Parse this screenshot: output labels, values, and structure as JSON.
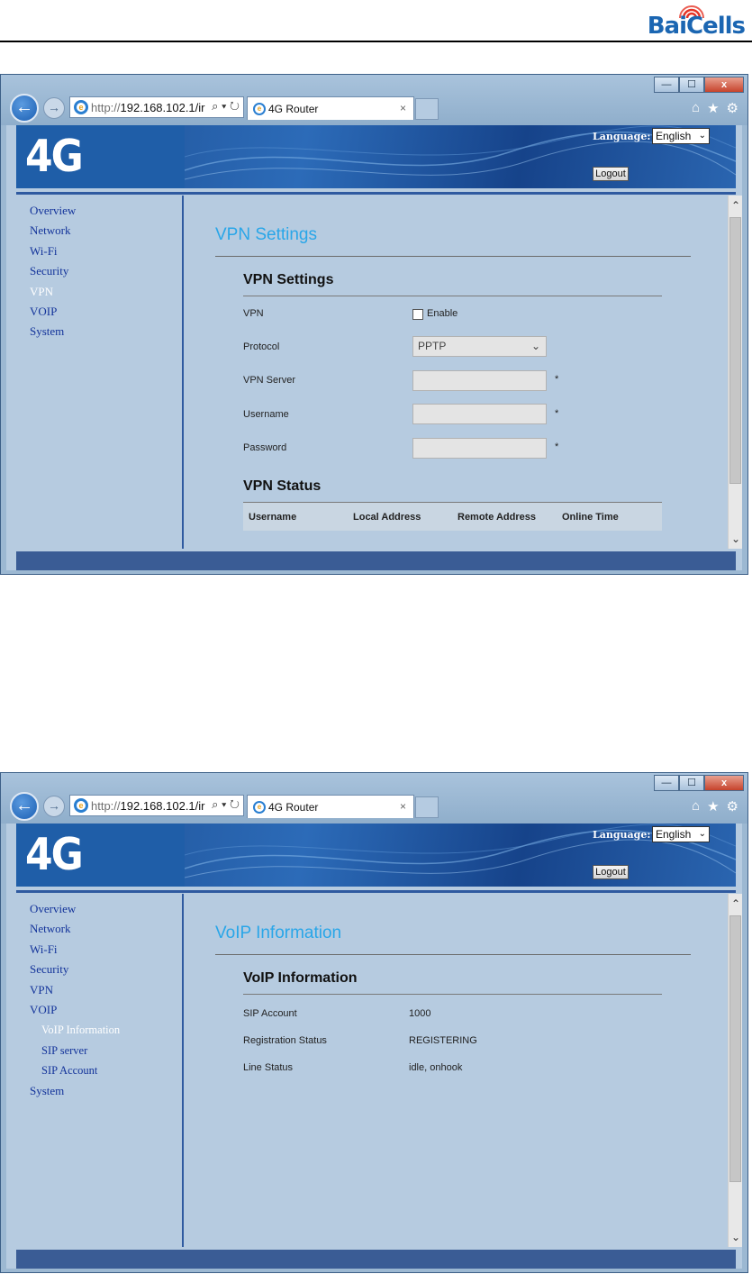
{
  "doc_logo": {
    "text": "BaiCells"
  },
  "browser": {
    "url_proto": "http://",
    "url_host": "192.168.102.1/ir",
    "addr_tools": "⌕ ▾ ↻",
    "tab_title": "4G Router",
    "tab_close": "×",
    "controls": {
      "minimize": "—",
      "maximize": "☐",
      "close": "x"
    },
    "cmd": {
      "home": "⌂",
      "star": "★",
      "gear": "⚙"
    }
  },
  "router": {
    "brand": "4G Router",
    "language_label": "Language:",
    "language_value": "English",
    "logout_label": "Logout"
  },
  "window1": {
    "nav": [
      "Overview",
      "Network",
      "Wi-Fi",
      "Security",
      "VPN",
      "VOIP",
      "System"
    ],
    "active_nav": "VPN",
    "page_title": "VPN Settings",
    "section_title": "VPN Settings",
    "fields": {
      "vpn_label": "VPN",
      "enable_label": "Enable",
      "protocol_label": "Protocol",
      "protocol_value": "PPTP",
      "server_label": "VPN Server",
      "username_label": "Username",
      "password_label": "Password",
      "required_mark": "*"
    },
    "status_title": "VPN Status",
    "status_columns": [
      "Username",
      "Local Address",
      "Remote Address",
      "Online Time"
    ]
  },
  "window2": {
    "nav": [
      "Overview",
      "Network",
      "Wi-Fi",
      "Security",
      "VPN",
      "VOIP"
    ],
    "sub_nav": [
      "VoIP Information",
      "SIP server",
      "SIP Account"
    ],
    "nav_after": [
      "System"
    ],
    "active_nav": "VoIP Information",
    "page_title": "VoIP Information",
    "section_title": "VoIP Information",
    "rows": [
      {
        "label": "SIP Account",
        "value": "1000"
      },
      {
        "label": "Registration Status",
        "value": "REGISTERING"
      },
      {
        "label": "Line Status",
        "value": "idle, onhook"
      }
    ]
  },
  "scrollbar": {
    "up": "⌃",
    "down": "⌄"
  }
}
